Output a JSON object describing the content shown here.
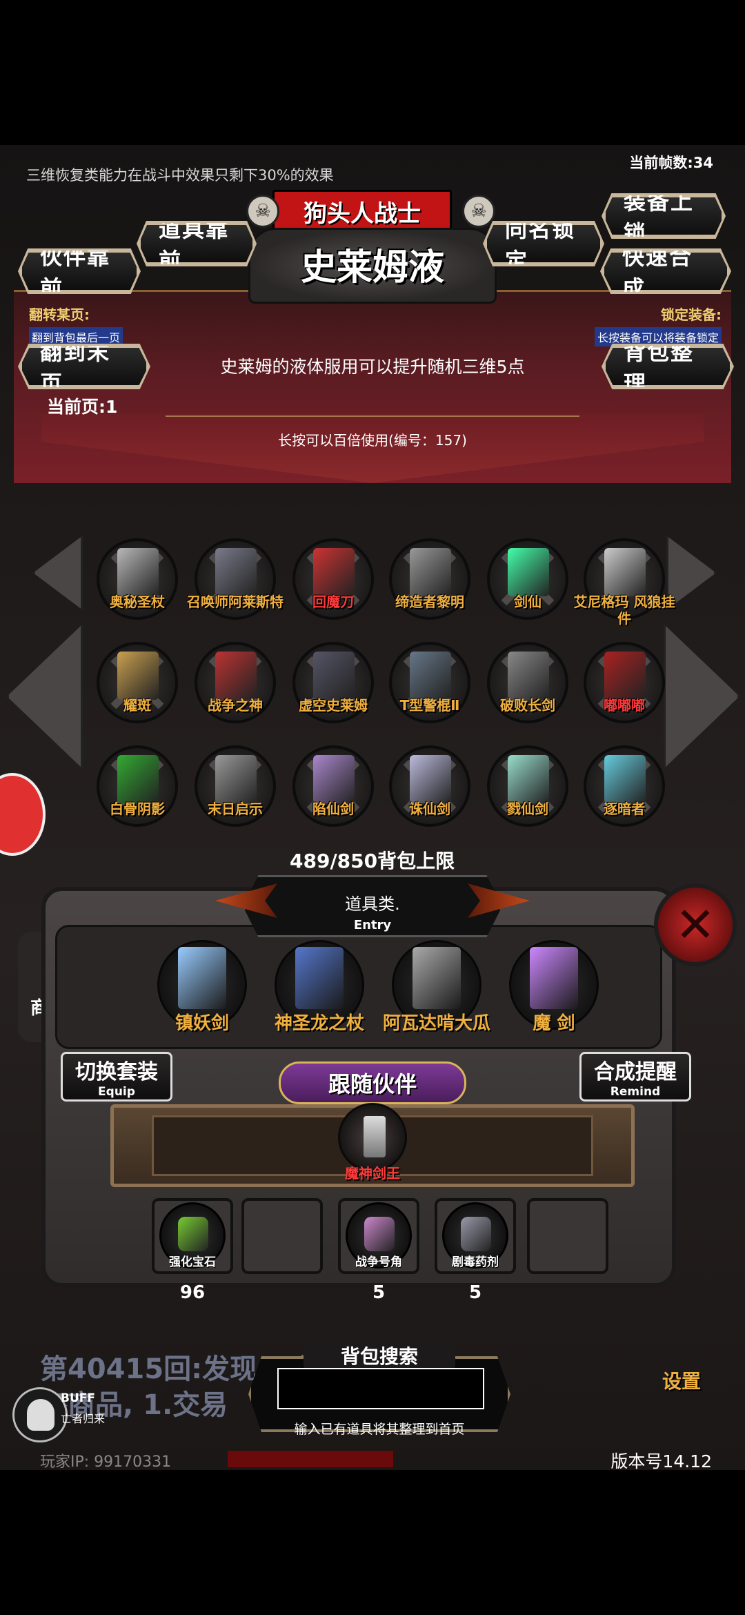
{
  "status": {
    "top_info": "三维恢复类能力在战斗中效果只剩下30%的效果",
    "fps": "当前帧数:34"
  },
  "item_detail": {
    "category_tag": "狗头人战士",
    "name": "史莱姆液",
    "description": "史莱姆的液体服用可以提升随机三维5点",
    "usage_hint": "长按可以百倍使用(编号：157)",
    "current_page": "当前页:1",
    "flip_label": "翻转某页:",
    "flip_sub": "翻到背包最后一页",
    "lock_label": "锁定装备:",
    "lock_sub": "长按装备可以将装备锁定"
  },
  "buttons": {
    "item_front": "道具靠前",
    "partner_front": "伙伴靠前",
    "same_name_lock": "同名锁定",
    "equip_lock": "装备上锁",
    "quick_merge": "快速合成",
    "to_last_page": "翻到末页",
    "sort_bag": "背包整理",
    "switch_set": "切换套装",
    "switch_set_sub": "Equip",
    "merge_remind": "合成提醒",
    "merge_remind_sub": "Remind",
    "follow_partner": "跟随伙伴",
    "settings": "设置",
    "shop": "商"
  },
  "inventory": {
    "items": [
      {
        "label": "奥秘圣杖",
        "color": "#b8b8b8",
        "red": false
      },
      {
        "label": "召唤师阿莱斯特",
        "color": "#7a7a8a",
        "red": false
      },
      {
        "label": "回魔刀",
        "color": "#c33",
        "red": true
      },
      {
        "label": "缔造者黎明",
        "color": "#999",
        "red": false
      },
      {
        "label": "剑仙",
        "color": "#4fa",
        "red": false
      },
      {
        "label": "艾尼格玛\n风狼挂件",
        "color": "#ccc",
        "red": false
      },
      {
        "label": "耀斑",
        "color": "#c9a050",
        "red": false
      },
      {
        "label": "战争之神",
        "color": "#b33",
        "red": false
      },
      {
        "label": "虚空史莱姆",
        "color": "#556",
        "red": false
      },
      {
        "label": "T型警棍Ⅱ",
        "color": "#678",
        "red": false
      },
      {
        "label": "破败长剑",
        "color": "#888",
        "red": false
      },
      {
        "label": "嘟嘟嘟",
        "color": "#a22",
        "red": true
      },
      {
        "label": "白骨阴影",
        "color": "#3a3",
        "red": false
      },
      {
        "label": "末日启示",
        "color": "#999",
        "red": false
      },
      {
        "label": "陷仙剑",
        "color": "#a8c",
        "red": false
      },
      {
        "label": "诛仙剑",
        "color": "#bbd",
        "red": false
      },
      {
        "label": "戮仙剑",
        "color": "#9dc",
        "red": false
      },
      {
        "label": "逐暗者",
        "color": "#6cd",
        "red": false
      }
    ],
    "capacity": "489/850背包上限"
  },
  "equipment": {
    "title": "道具类.",
    "subtitle": "Entry",
    "items": [
      {
        "label": "镇妖剑",
        "color": "#9cf"
      },
      {
        "label": "神圣龙之杖",
        "color": "#57c"
      },
      {
        "label": "阿瓦达啃大瓜",
        "color": "#aaa"
      },
      {
        "label": "魔 剑",
        "color": "#c8f"
      }
    ]
  },
  "partner": {
    "name": "魔神剑王"
  },
  "quick_slots": [
    {
      "name": "强化宝石",
      "count": "96",
      "color": "#7c3"
    },
    {
      "name": "",
      "count": "",
      "color": ""
    },
    {
      "name": "战争号角",
      "count": "5",
      "color": "#c8c"
    },
    {
      "name": "剧毒药剂",
      "count": "5",
      "color": "#99a"
    },
    {
      "name": "",
      "count": "",
      "color": ""
    }
  ],
  "log": {
    "line1": "第40415回:发现一           伍好像有",
    "line2": "各商品, 1.交易"
  },
  "search": {
    "title": "背包搜索",
    "placeholder": "",
    "hint": "输入已有道具将其整理到首页"
  },
  "buff": {
    "label": "BUFF",
    "sub": "亡者归来"
  },
  "footer": {
    "player_ip": "玩家IP: 99170331",
    "version": "版本号14.12"
  }
}
